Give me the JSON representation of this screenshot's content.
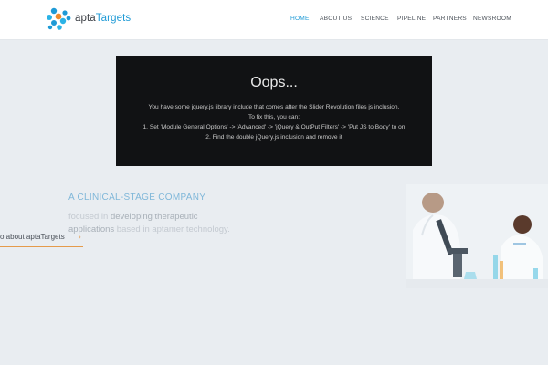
{
  "brand": {
    "name_prefix": "apta",
    "name_suffix": "Targets",
    "accent_color": "#1e9ad6",
    "logo_icon": "molecule-logo-icon"
  },
  "nav": {
    "items": [
      {
        "label": "HOME",
        "active": true
      },
      {
        "label": "ABOUT US",
        "active": false
      },
      {
        "label": "SCIENCE",
        "active": false
      },
      {
        "label": "PIPELINE",
        "active": false
      },
      {
        "label": "PARTNERS",
        "active": false
      },
      {
        "label": "NEWSROOM",
        "active": false
      }
    ]
  },
  "error": {
    "title": "Oops...",
    "lines": [
      "You have some jquery.js library include that comes after the Slider Revolution files js inclusion.",
      "To fix this, you can:",
      "1. Set 'Module General Options' -> 'Advanced' -> 'jQuery & OutPut Filters' -> 'Put JS to Body' to on",
      "2. Find the double jQuery.js inclusion and remove it"
    ]
  },
  "hero": {
    "heading": "A CLINICAL-STAGE COMPANY",
    "line1_pre": "focused in ",
    "line1_strong": "developing therapeutic",
    "line2_strong": "applications",
    "line2_post": " based in aptamer technology.",
    "about_link": "o about aptaTargets",
    "about_chevron": "›",
    "image_icon": "laboratory-scientists-image"
  }
}
